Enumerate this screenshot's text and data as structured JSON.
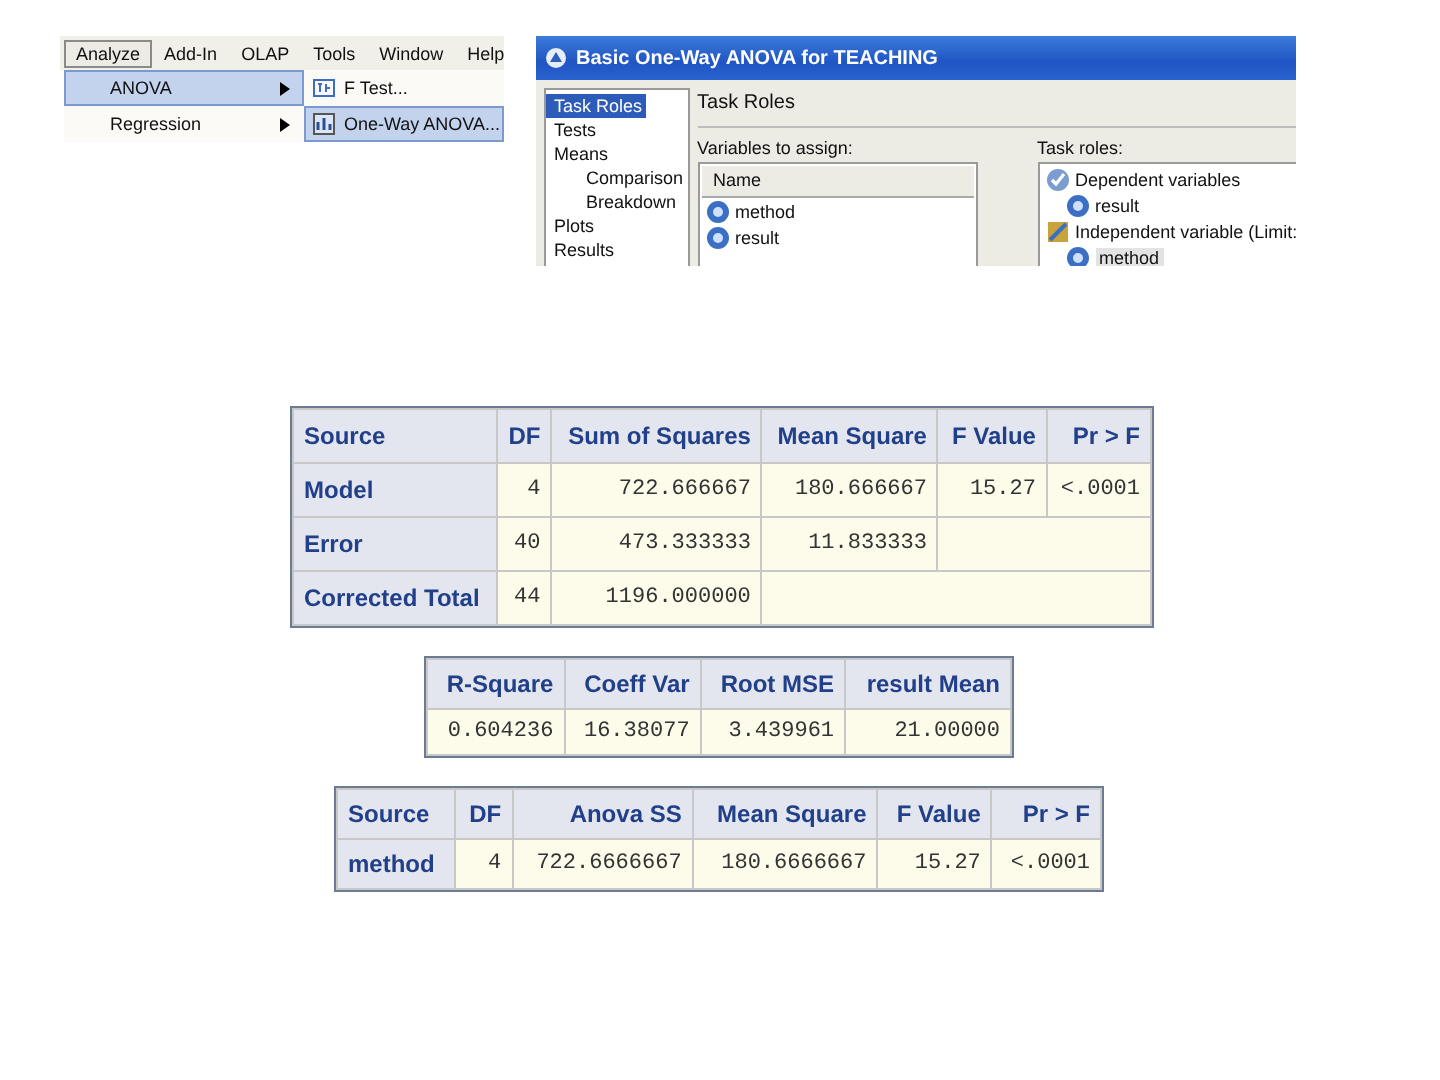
{
  "menu": {
    "menubar": [
      {
        "label": "Analyze",
        "selected": true
      },
      {
        "label": "Add-In",
        "selected": false
      },
      {
        "label": "OLAP",
        "selected": false
      },
      {
        "label": "Tools",
        "selected": false
      },
      {
        "label": "Window",
        "selected": false
      },
      {
        "label": "Help",
        "selected": false
      }
    ],
    "submenu": [
      {
        "label": "ANOVA",
        "selected": true
      },
      {
        "label": "Regression",
        "selected": false
      }
    ],
    "submenu_anova": [
      {
        "label": "F Test...",
        "selected": false
      },
      {
        "label": "One-Way ANOVA...",
        "selected": true
      }
    ]
  },
  "dialog": {
    "title": "Basic One-Way ANOVA for TEACHING",
    "nav": [
      {
        "label": "Task Roles",
        "selected": true
      },
      {
        "label": "Tests",
        "selected": false
      },
      {
        "label": "Means",
        "selected": false,
        "children": [
          {
            "label": "Comparison",
            "selected": false
          },
          {
            "label": "Breakdown",
            "selected": false
          }
        ]
      },
      {
        "label": "Plots",
        "selected": false
      },
      {
        "label": "Results",
        "selected": false
      }
    ],
    "heading": "Task Roles",
    "variables_label": "Variables to assign:",
    "variables_header": "Name",
    "variables": [
      {
        "label": "method"
      },
      {
        "label": "result"
      }
    ],
    "roles_label": "Task roles:",
    "roles": [
      {
        "label": "Dependent variables",
        "children": [
          {
            "label": "result",
            "selected": false
          }
        ]
      },
      {
        "label": "Independent variable (Limit:",
        "children": [
          {
            "label": "method",
            "selected": true
          }
        ]
      }
    ]
  },
  "tables": [
    {
      "columns": [
        "Source",
        "DF",
        "Sum of Squares",
        "Mean Square",
        "F Value",
        "Pr > F"
      ],
      "rows": [
        [
          "Model",
          "4",
          "722.666667",
          "180.666667",
          "15.27",
          "<.0001"
        ],
        [
          "Error",
          "40",
          "473.333333",
          "11.833333"
        ],
        [
          "Corrected Total",
          "44",
          "1196.000000"
        ]
      ]
    },
    {
      "columns": [
        "R-Square",
        "Coeff Var",
        "Root MSE",
        "result Mean"
      ],
      "rows": [
        [
          "0.604236",
          "16.38077",
          "3.439961",
          "21.00000"
        ]
      ]
    },
    {
      "columns": [
        "Source",
        "DF",
        "Anova SS",
        "Mean Square",
        "F Value",
        "Pr > F"
      ],
      "rows": [
        [
          "method",
          "4",
          "722.6666667",
          "180.6666667",
          "15.27",
          "<.0001"
        ]
      ]
    }
  ]
}
